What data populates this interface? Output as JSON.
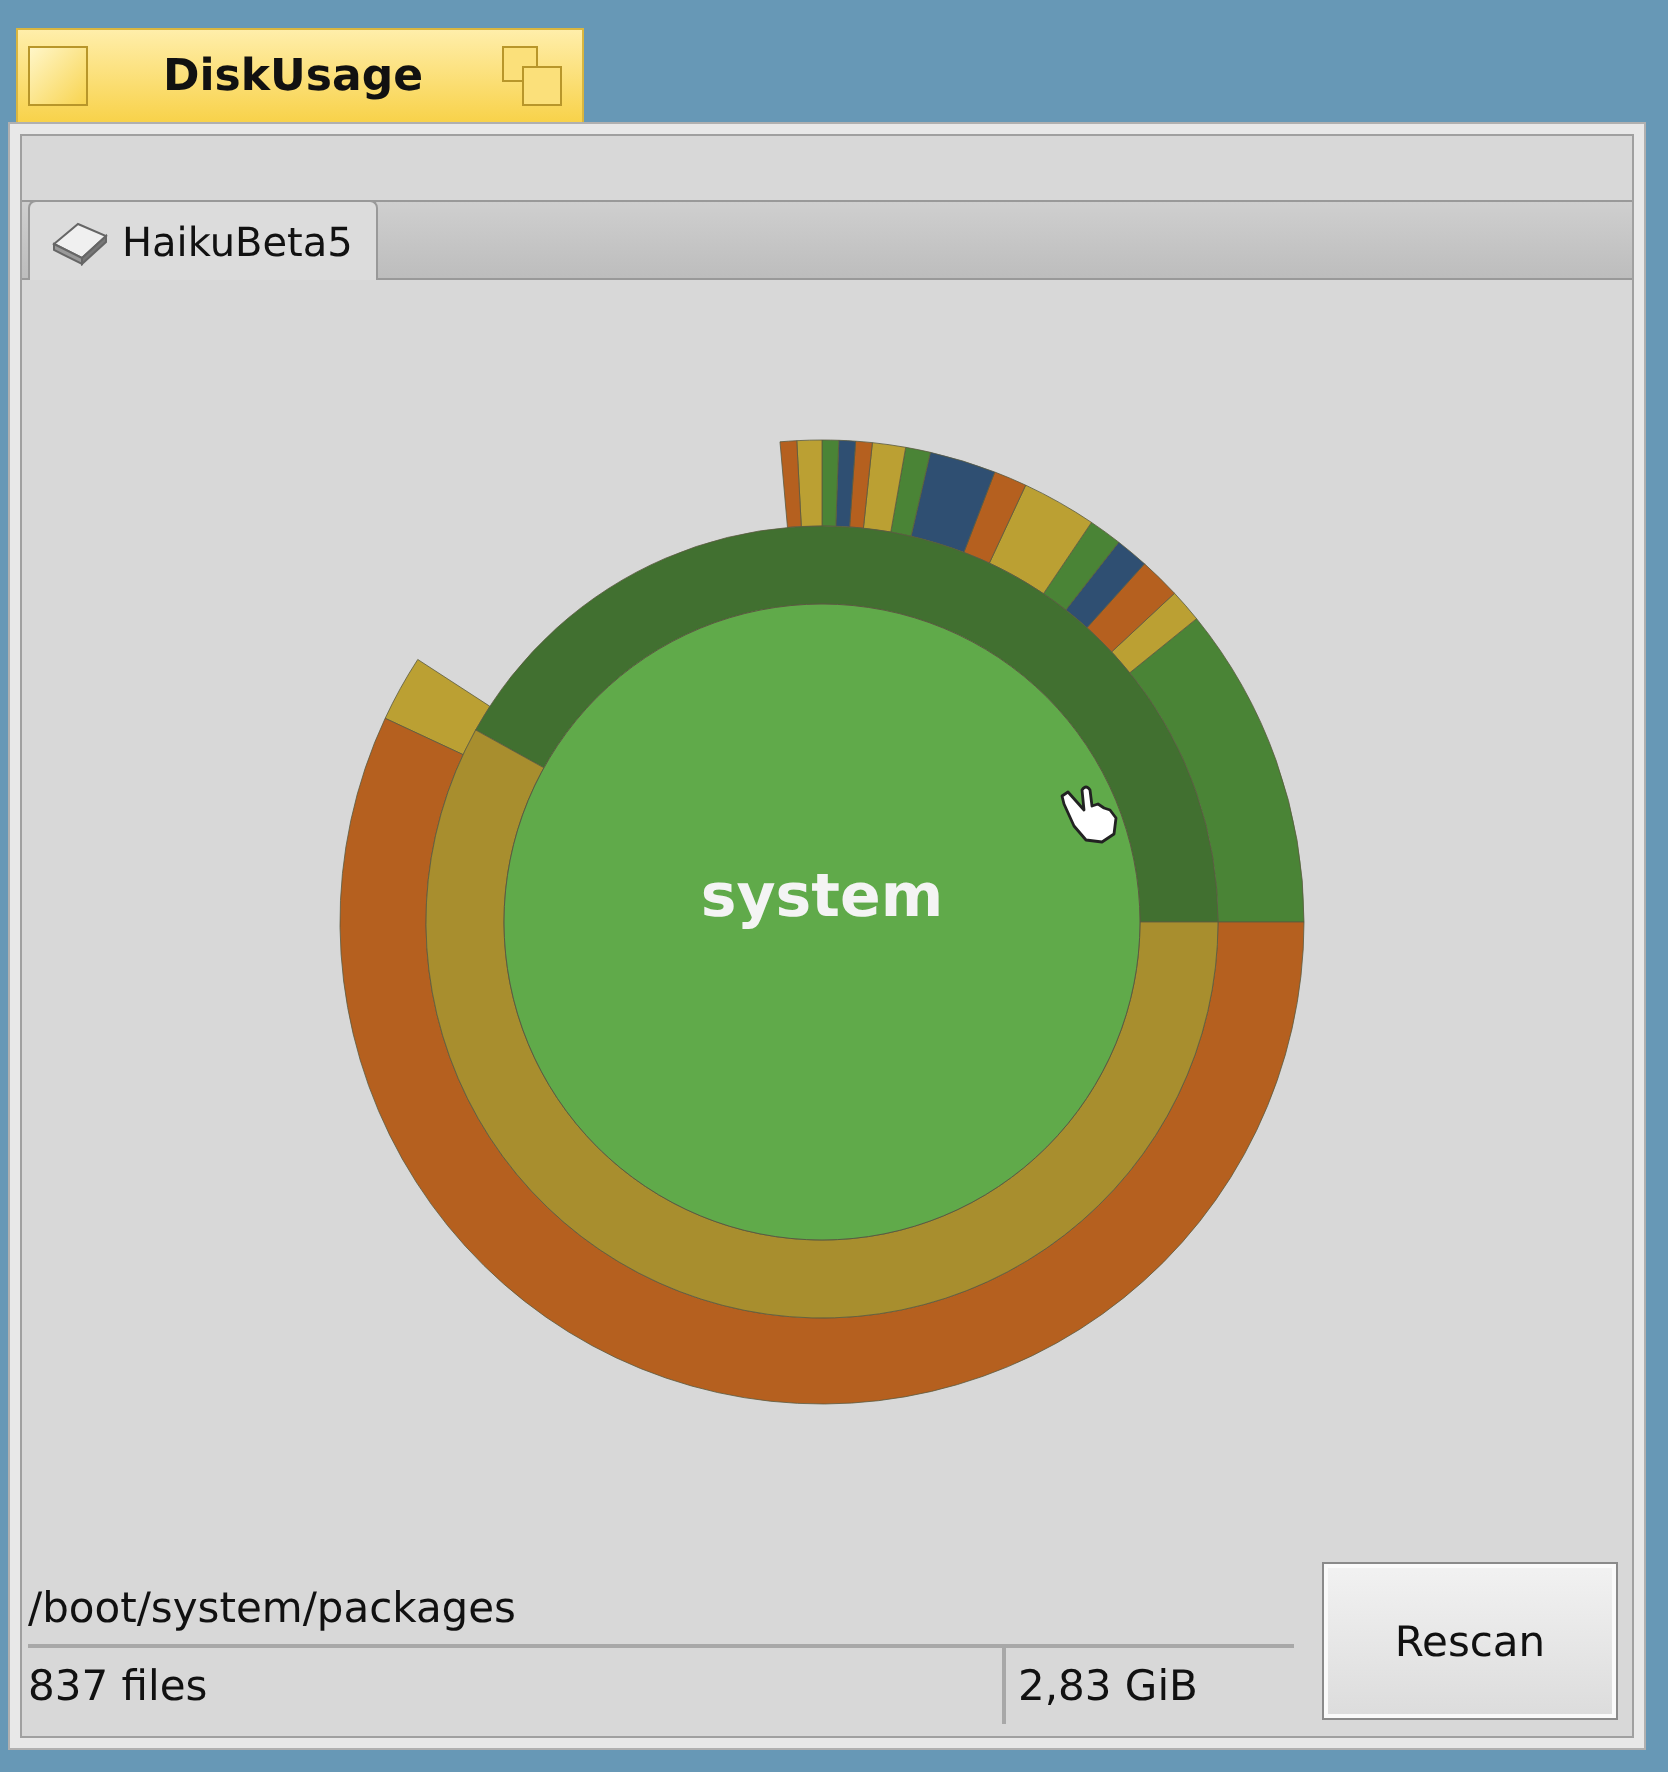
{
  "window": {
    "title": "DiskUsage"
  },
  "tabs": [
    {
      "label": "HaikuBeta5",
      "selected": true
    }
  ],
  "chart": {
    "center_label": "system"
  },
  "status": {
    "path": "/boot/system/packages",
    "files": "837 files",
    "size": "2,83 GiB"
  },
  "buttons": [
    "Rescan"
  ]
}
